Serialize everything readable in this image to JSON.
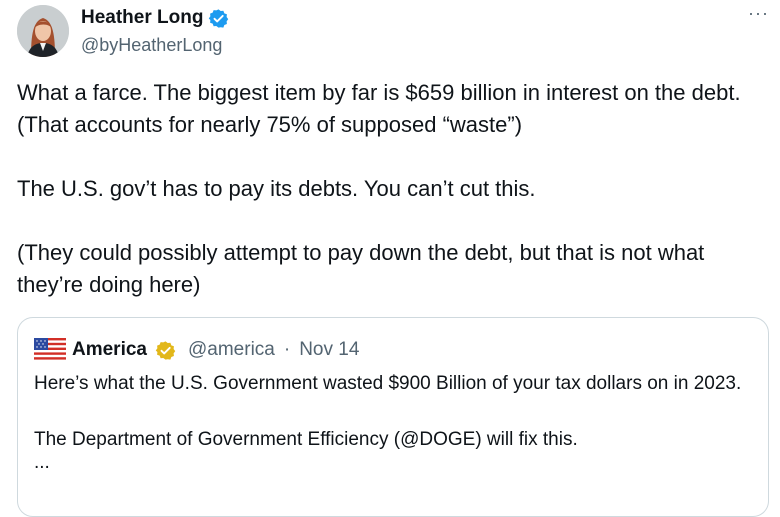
{
  "author": {
    "display_name": "Heather Long",
    "handle": "@byHeatherLong",
    "verified_color": "#1d9bf0"
  },
  "more_label": "···",
  "tweet": {
    "paragraphs": [
      "What a farce. The biggest item by far is $659 billion in interest on the debt. (That accounts for nearly 75% of supposed “waste”)",
      "The U.S. gov’t has to pay its debts. You can’t cut this.",
      "(They could possibly attempt to pay down the debt, but that is not what they’re doing here)"
    ]
  },
  "quoted": {
    "display_name": "America",
    "handle": "@america",
    "separator": "·",
    "timestamp": "Nov 14",
    "badge_color": "#e2b719",
    "paragraphs": [
      "Here’s what the U.S. Government wasted $900 Billion of your tax dollars on in 2023.",
      "The Department of Government Efficiency (@DOGE) will fix this.",
      "..."
    ]
  }
}
